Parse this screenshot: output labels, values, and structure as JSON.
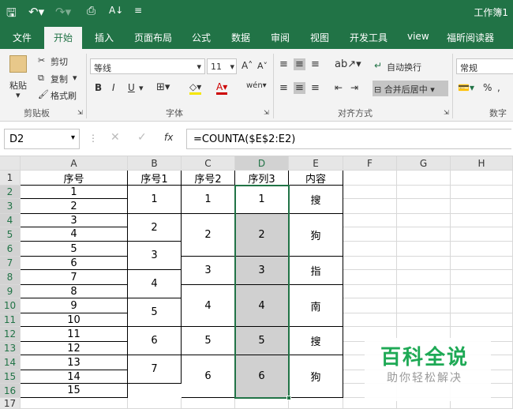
{
  "title": {
    "workbook": "工作簿1"
  },
  "tabs": [
    "文件",
    "开始",
    "插入",
    "页面布局",
    "公式",
    "数据",
    "审阅",
    "视图",
    "开发工具",
    "view",
    "福昕阅读器"
  ],
  "ribbon": {
    "paste": "粘贴",
    "cut": "剪切",
    "copy": "复制",
    "format_painter": "格式刷",
    "clipboard": "剪贴板",
    "font_name": "等线",
    "font_size": "11",
    "bold": "B",
    "italic": "I",
    "underline": "U",
    "font_group": "字体",
    "wrap_text": "自动换行",
    "merge_center": "合并后居中",
    "align_group": "对齐方式",
    "number_format": "常规",
    "number_group": "数字",
    "percent": "%"
  },
  "formula_bar": {
    "name_box": "D2",
    "formula": "=COUNTA($E$2:E2)",
    "fx": "fx"
  },
  "columns": [
    "A",
    "B",
    "C",
    "D",
    "E",
    "F",
    "G",
    "H"
  ],
  "rows": [
    "1",
    "2",
    "3",
    "4",
    "5",
    "6",
    "7",
    "8",
    "9",
    "10",
    "11",
    "12",
    "13",
    "14",
    "15",
    "16",
    "17"
  ],
  "headers": {
    "A": "序号",
    "B": "序号1",
    "C": "序号2",
    "D": "序列3",
    "E": "内容"
  },
  "colA": [
    "1",
    "2",
    "3",
    "4",
    "5",
    "6",
    "7",
    "8",
    "9",
    "10",
    "11",
    "12",
    "13",
    "14",
    "15"
  ],
  "colB": [
    "1",
    "2",
    "3",
    "4",
    "5",
    "6",
    "7"
  ],
  "colC": [
    "1",
    "2",
    "3",
    "4",
    "5",
    "6"
  ],
  "colD": [
    "1",
    "2",
    "3",
    "4",
    "5",
    "6"
  ],
  "colE": [
    "搜",
    "狗",
    "指",
    "南",
    "搜",
    "狗"
  ],
  "watermark": {
    "line1": "百科全说",
    "line2": "助你轻松解决"
  }
}
